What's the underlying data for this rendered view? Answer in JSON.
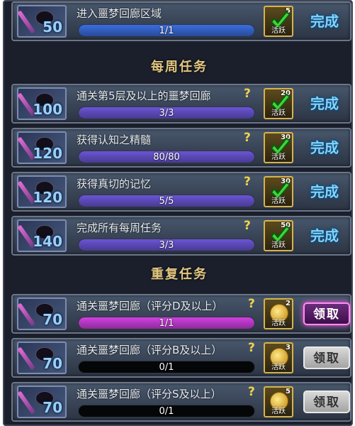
{
  "colors": {
    "bar_blue": "#3a6de0",
    "bar_purple": "#6a55d6",
    "bar_magenta": "#d23fe2",
    "status_text": "#7fd4ff",
    "section_title": "#e3c680"
  },
  "top_task": {
    "value": "50",
    "title": "进入噩梦回廊区域",
    "progress_text": "1/1",
    "progress_fraction": 1,
    "reward_num": "5",
    "reward_label": "活跃",
    "status": "完成"
  },
  "weekly": {
    "title": "每周任务",
    "tasks": [
      {
        "value": "100",
        "title": "通关第5层及以上的噩梦回廊",
        "help": "?",
        "progress_text": "3/3",
        "progress_fraction": 1,
        "reward_num": "20",
        "reward_label": "活跃",
        "status": "完成"
      },
      {
        "value": "120",
        "title": "获得认知之精髓",
        "help": "?",
        "progress_text": "80/80",
        "progress_fraction": 1,
        "reward_num": "30",
        "reward_label": "活跃",
        "status": "完成"
      },
      {
        "value": "120",
        "title": "获得真切的记忆",
        "help": "?",
        "progress_text": "5/5",
        "progress_fraction": 1,
        "reward_num": "30",
        "reward_label": "活跃",
        "status": "完成"
      },
      {
        "value": "140",
        "title": "完成所有每周任务",
        "help": "?",
        "progress_text": "3/3",
        "progress_fraction": 1,
        "reward_num": "50",
        "reward_label": "活跃",
        "status": "完成"
      }
    ]
  },
  "repeat": {
    "title": "重复任务",
    "tasks": [
      {
        "value": "70",
        "title": "通关噩梦回廊（评分D及以上）",
        "help": "?",
        "progress_text": "1/1",
        "progress_fraction": 1,
        "reward_num": "2",
        "reward_label": "活跃",
        "button": "领取"
      },
      {
        "value": "70",
        "title": "通关噩梦回廊（评分B及以上）",
        "help": "?",
        "progress_text": "0/1",
        "progress_fraction": 0,
        "reward_num": "3",
        "reward_label": "活跃",
        "button": "领取"
      },
      {
        "value": "70",
        "title": "通关噩梦回廊（评分S及以上）",
        "help": "?",
        "progress_text": "0/1",
        "progress_fraction": 0,
        "reward_num": "5",
        "reward_label": "活跃",
        "button": "领取"
      }
    ]
  }
}
